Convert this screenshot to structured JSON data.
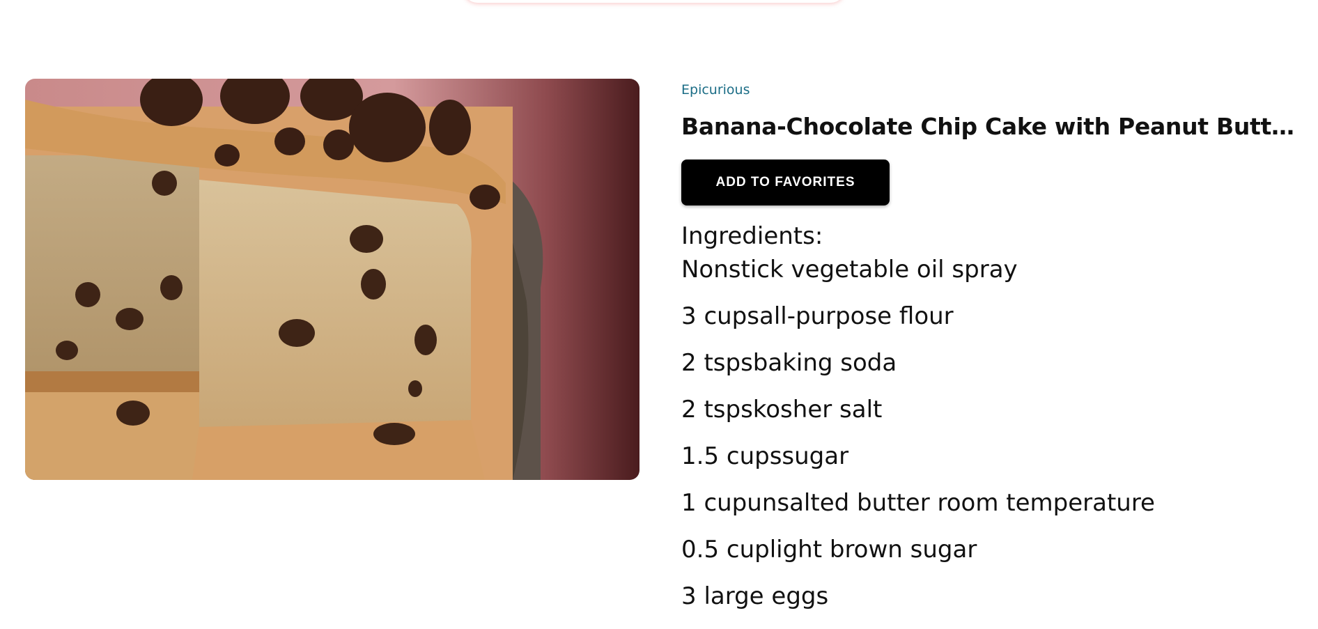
{
  "recipe": {
    "source": "Epicurious",
    "title": "Banana-Chocolate Chip Cake with Peanut Butter F...",
    "favorite_label": "ADD TO FAVORITES",
    "image_name": "cake-photo"
  },
  "ingredients": {
    "heading": "Ingredients:",
    "items": [
      "Nonstick vegetable oil spray",
      "3 cupsall-purpose flour",
      "2 tspsbaking soda",
      "2 tspskosher salt",
      "1.5 cupssugar",
      "1 cupunsalted butter room temperature",
      "0.5 cuplight brown sugar",
      "3 large eggs"
    ]
  },
  "colors": {
    "source_link": "#1b6d86",
    "button_bg": "#000000",
    "button_text": "#ffffff"
  }
}
